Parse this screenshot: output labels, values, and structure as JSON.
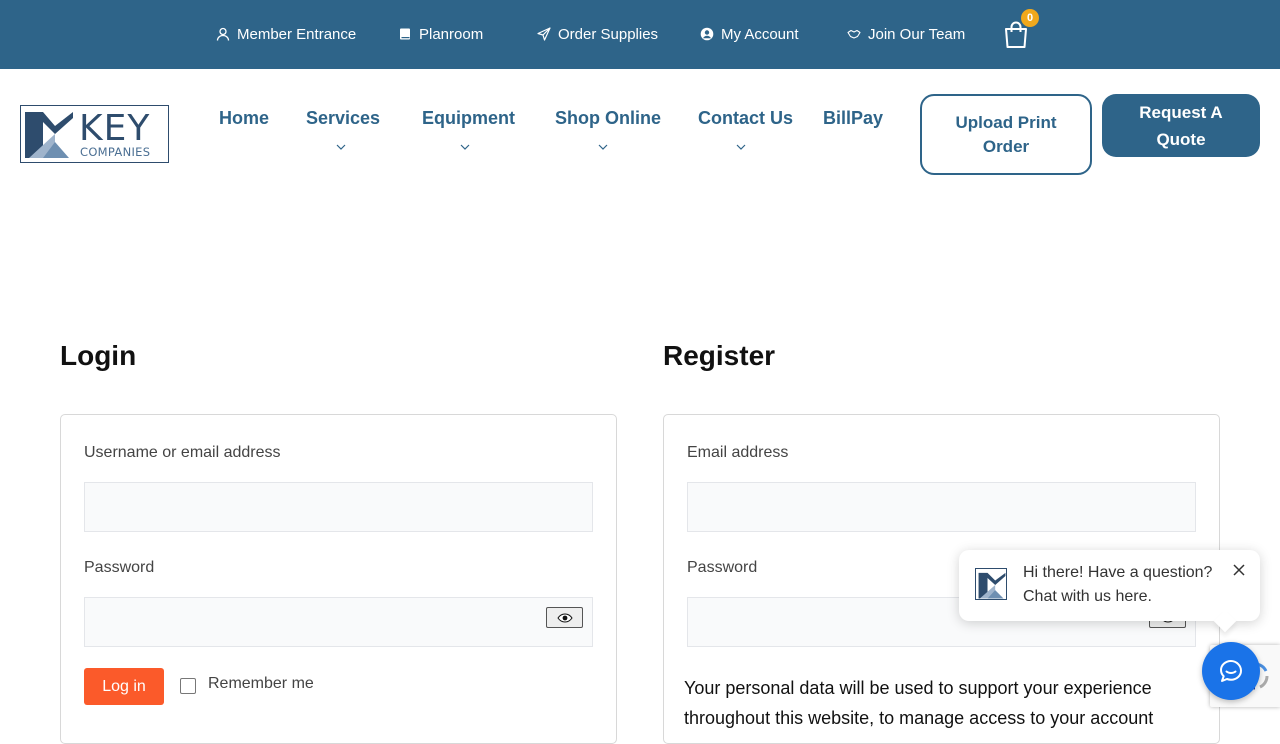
{
  "topbar": {
    "links": [
      "Member Entrance",
      "Planroom",
      "Order Supplies",
      "My Account",
      "Join Our Team"
    ],
    "cart_count": "0"
  },
  "logo": {
    "name": "KEY",
    "sub": "COMPANIES"
  },
  "nav": {
    "items": [
      "Home",
      "Services",
      "Equipment",
      "Shop Online",
      "Contact Us",
      "BillPay"
    ],
    "upload_btn": "Upload Print Order",
    "quote_btn": "Request A Quote"
  },
  "login": {
    "title": "Login",
    "username_label": "Username or email address",
    "username_value": "",
    "password_label": "Password",
    "password_value": "",
    "button": "Log in",
    "remember": "Remember me"
  },
  "register": {
    "title": "Register",
    "email_label": "Email address",
    "email_value": "",
    "password_label": "Password",
    "password_value": "",
    "privacy_text": "Your personal data will be used to support your experience throughout this website, to manage access to your account"
  },
  "chat": {
    "line1": "Hi there! Have a question?",
    "line2": "Chat with us here."
  },
  "colors": {
    "brand": "#2e6489",
    "accent": "#fb5a2a",
    "chat": "#1a73e8"
  }
}
